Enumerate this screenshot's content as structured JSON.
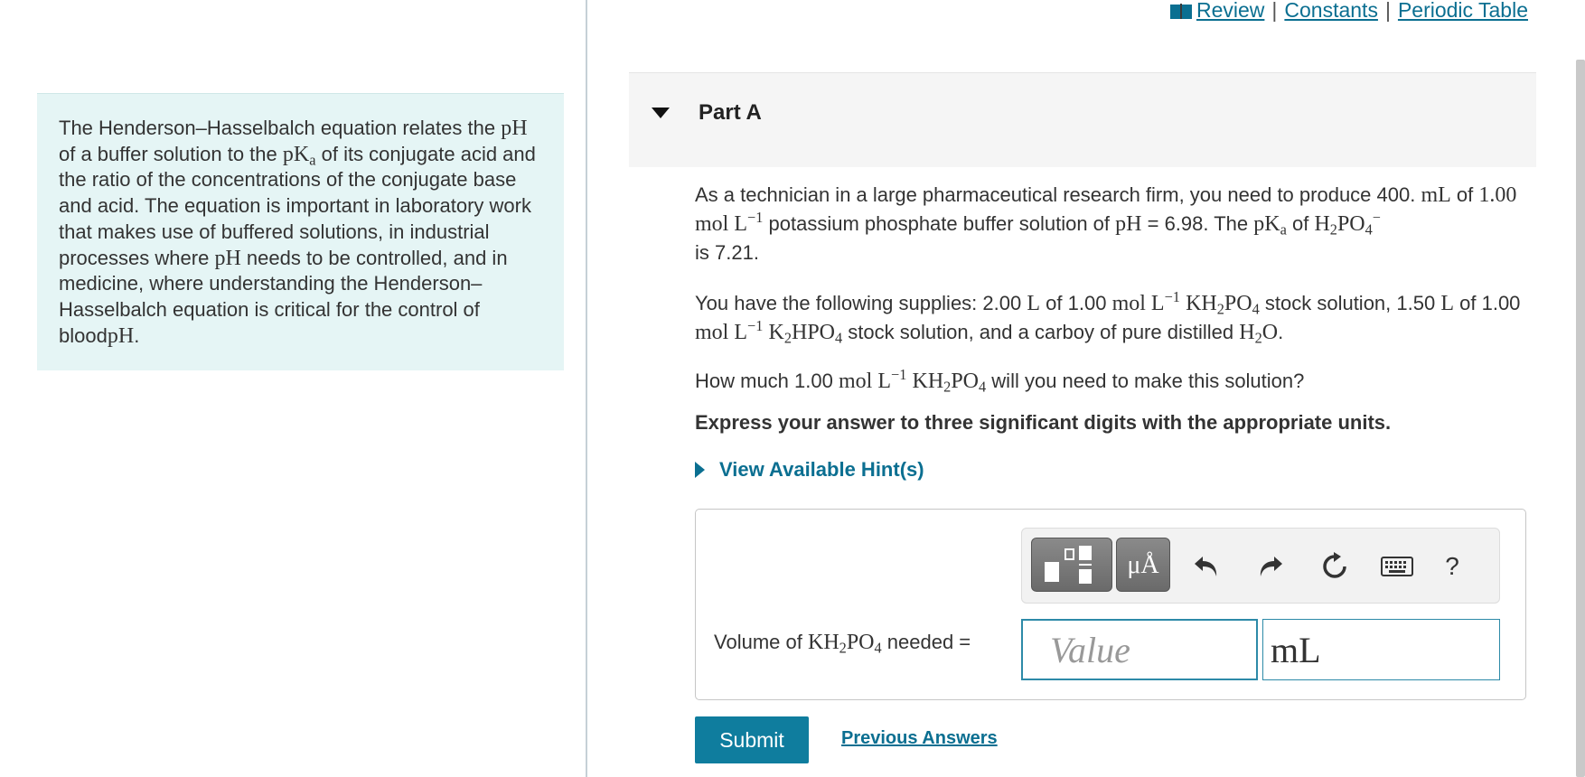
{
  "intro": {
    "s1": "The Henderson–Hasselbalch equation relates the",
    "m_pH": "pH",
    "s2": "of a buffer solution to the",
    "m_p": "pK",
    "m_a": "a",
    "s3": "of its conjugate acid and the ratio of the concentrations of the conjugate base and acid. The equation is important in laboratory work that makes use of buffered solutions, in industrial processes where",
    "s4": "needs to be controlled, and in medicine, where understanding the Henderson–Hasselbalch equation is critical for the control of blood",
    "s5": "."
  },
  "toplinks": {
    "review": "Review",
    "constants": "Constants",
    "periodic_table": "Periodic Table",
    "sep": "|"
  },
  "part": {
    "title": "Part A"
  },
  "question": {
    "p1_a": "As a technician in a large pharmaceutical research firm, you need to produce 400.",
    "p1_b": "of",
    "p1_c": "potassium phosphate buffer solution of",
    "p1_d": "= 6.98. The",
    "p1_e": "of",
    "p1_f": "is 7.21.",
    "p2_a": "You have the following supplies: 2.00",
    "p2_b": "of 1.00",
    "p2_c": "stock solution, 1.50",
    "p2_d": "of 1.00",
    "p2_e": "stock solution, and a carboy of pure distilled",
    "p2_f": ".",
    "p3_a": "How much 1.00",
    "p3_b": "will you need to make this solution?",
    "express": "Express your answer to three significant digits with the appropriate units.",
    "hint": "View Available Hint(s)"
  },
  "math": {
    "mL": "mL",
    "one": "1.00",
    "mol": "mol",
    "L": "L",
    "neg1": "−1",
    "minus": "−",
    "pH": "pH",
    "pK": "pK",
    "a": "a",
    "H": "H",
    "K": "K",
    "two": "2",
    "four": "4",
    "PO": "PO",
    "HPO": "HPO",
    "O": "O"
  },
  "answer": {
    "mu_a": "μÅ",
    "help": "?",
    "label_pre": "Volume of",
    "label_post": "needed =",
    "value_placeholder": "Value",
    "unit_value": "mL"
  },
  "actions": {
    "submit": "Submit",
    "previous": "Previous Answers"
  }
}
